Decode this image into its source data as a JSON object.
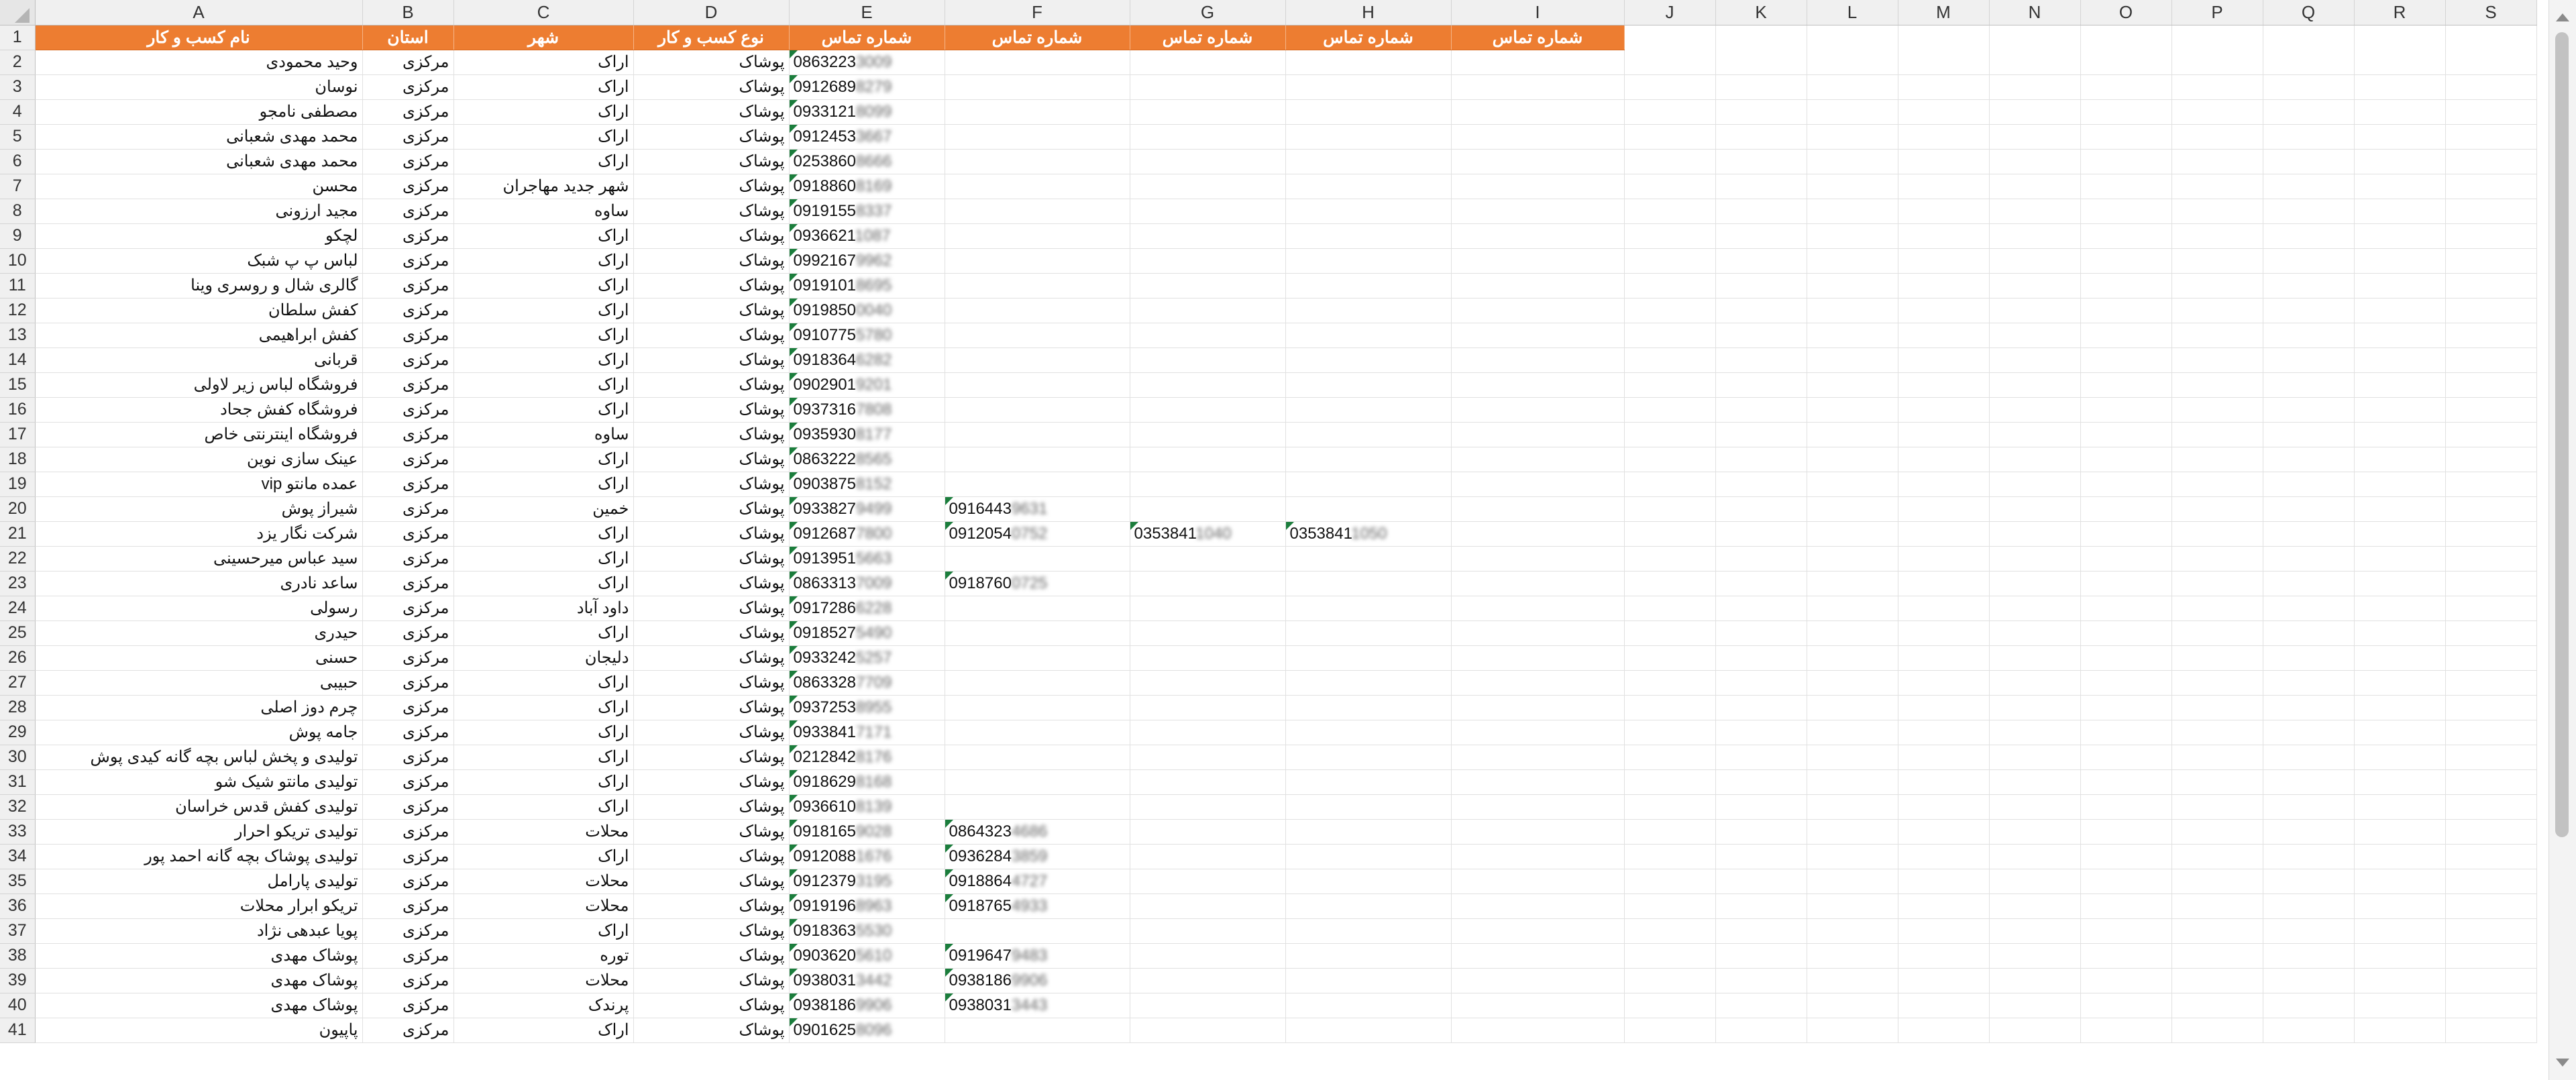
{
  "columns": [
    "A",
    "B",
    "C",
    "D",
    "E",
    "F",
    "G",
    "H",
    "I",
    "J",
    "K",
    "L",
    "M",
    "N",
    "O",
    "P",
    "Q",
    "R",
    "S"
  ],
  "header": {
    "name": "نام کسب و کار",
    "province": "استان",
    "city": "شهر",
    "type": "نوع کسب و کار",
    "p1": "شماره تماس",
    "p2": "شماره تماس",
    "p3": "شماره تماس",
    "p4": "شماره تماس",
    "p5": "شماره تماس"
  },
  "rows": [
    {
      "n": "2",
      "name": "وحید محمودی",
      "province": "مرکزی",
      "city": "اراک",
      "type": "پوشاک",
      "p1": "0863223",
      "p1b": "3009"
    },
    {
      "n": "3",
      "name": "نوسان",
      "province": "مرکزی",
      "city": "اراک",
      "type": "پوشاک",
      "p1": "0912689",
      "p1b": "8279"
    },
    {
      "n": "4",
      "name": "مصطفی نامجو",
      "province": "مرکزی",
      "city": "اراک",
      "type": "پوشاک",
      "p1": "0933121",
      "p1b": "8099"
    },
    {
      "n": "5",
      "name": "محمد مهدی شعبانی",
      "province": "مرکزی",
      "city": "اراک",
      "type": "پوشاک",
      "p1": "0912453",
      "p1b": "3667"
    },
    {
      "n": "6",
      "name": "محمد مهدی شعبانی",
      "province": "مرکزی",
      "city": "اراک",
      "type": "پوشاک",
      "p1": "0253860",
      "p1b": "8666"
    },
    {
      "n": "7",
      "name": "محسن",
      "province": "مرکزی",
      "city": "شهر جدید مهاجران",
      "type": "پوشاک",
      "p1": "0918860",
      "p1b": "8169"
    },
    {
      "n": "8",
      "name": "مجید ارزونی",
      "province": "مرکزی",
      "city": "ساوه",
      "type": "پوشاک",
      "p1": "0919155",
      "p1b": "8337"
    },
    {
      "n": "9",
      "name": "لچکو",
      "province": "مرکزی",
      "city": "اراک",
      "type": "پوشاک",
      "p1": "0936621",
      "p1b": "1087"
    },
    {
      "n": "10",
      "name": "لباس پ پ شبک",
      "province": "مرکزی",
      "city": "اراک",
      "type": "پوشاک",
      "p1": "0992167",
      "p1b": "9962"
    },
    {
      "n": "11",
      "name": "گالری شال و روسری وینا",
      "province": "مرکزی",
      "city": "اراک",
      "type": "پوشاک",
      "p1": "0919101",
      "p1b": "8695"
    },
    {
      "n": "12",
      "name": "کفش سلطان",
      "province": "مرکزی",
      "city": "اراک",
      "type": "پوشاک",
      "p1": "0919850",
      "p1b": "0040"
    },
    {
      "n": "13",
      "name": "کفش ابراهیمی",
      "province": "مرکزی",
      "city": "اراک",
      "type": "پوشاک",
      "p1": "0910775",
      "p1b": "5780"
    },
    {
      "n": "14",
      "name": "قربانی",
      "province": "مرکزی",
      "city": "اراک",
      "type": "پوشاک",
      "p1": "0918364",
      "p1b": "6282"
    },
    {
      "n": "15",
      "name": "فروشگاه لباس زیر لاولی",
      "province": "مرکزی",
      "city": "اراک",
      "type": "پوشاک",
      "p1": "0902901",
      "p1b": "9201"
    },
    {
      "n": "16",
      "name": "فروشگاه کفش جحاد",
      "province": "مرکزی",
      "city": "اراک",
      "type": "پوشاک",
      "p1": "0937316",
      "p1b": "7808"
    },
    {
      "n": "17",
      "name": "فروشگاه اینترنتی خاص",
      "province": "مرکزی",
      "city": "ساوه",
      "type": "پوشاک",
      "p1": "0935930",
      "p1b": "8177"
    },
    {
      "n": "18",
      "name": "عینک سازی نوین",
      "province": "مرکزی",
      "city": "اراک",
      "type": "پوشاک",
      "p1": "0863222",
      "p1b": "8565"
    },
    {
      "n": "19",
      "name": "عمده مانتو vip",
      "province": "مرکزی",
      "city": "اراک",
      "type": "پوشاک",
      "p1": "0903875",
      "p1b": "8152"
    },
    {
      "n": "20",
      "name": "شیراز پوش",
      "province": "مرکزی",
      "city": "خمین",
      "type": "پوشاک",
      "p1": "0933827",
      "p1b": "9499",
      "p2": "0916443",
      "p2b": "9631"
    },
    {
      "n": "21",
      "name": "شرکت نگار یزد",
      "province": "مرکزی",
      "city": "اراک",
      "type": "پوشاک",
      "p1": "0912687",
      "p1b": "7800",
      "p2": "0912054",
      "p2b": "0752",
      "p3": "0353841",
      "p3b": "1040",
      "p4": "0353841",
      "p4b": "1050"
    },
    {
      "n": "22",
      "name": "سید عباس میرحسینی",
      "province": "مرکزی",
      "city": "اراک",
      "type": "پوشاک",
      "p1": "0913951",
      "p1b": "5663"
    },
    {
      "n": "23",
      "name": "ساعد نادری",
      "province": "مرکزی",
      "city": "اراک",
      "type": "پوشاک",
      "p1": "0863313",
      "p1b": "7009",
      "p2": "0918760",
      "p2b": "0725"
    },
    {
      "n": "24",
      "name": "رسولی",
      "province": "مرکزی",
      "city": "داود آباد",
      "type": "پوشاک",
      "p1": "0917286",
      "p1b": "6228"
    },
    {
      "n": "25",
      "name": "حیدری",
      "province": "مرکزی",
      "city": "اراک",
      "type": "پوشاک",
      "p1": "0918527",
      "p1b": "5490"
    },
    {
      "n": "26",
      "name": "حسنی",
      "province": "مرکزی",
      "city": "دلیجان",
      "type": "پوشاک",
      "p1": "0933242",
      "p1b": "5257"
    },
    {
      "n": "27",
      "name": "حبیبی",
      "province": "مرکزی",
      "city": "اراک",
      "type": "پوشاک",
      "p1": "0863328",
      "p1b": "7709"
    },
    {
      "n": "28",
      "name": "چرم دوز اصلی",
      "province": "مرکزی",
      "city": "اراک",
      "type": "پوشاک",
      "p1": "0937253",
      "p1b": "8955"
    },
    {
      "n": "29",
      "name": "جامه پوش",
      "province": "مرکزی",
      "city": "اراک",
      "type": "پوشاک",
      "p1": "0933841",
      "p1b": "7171"
    },
    {
      "n": "30",
      "name": "تولیدی و پخش لباس بچه گانه کیدی پوش",
      "province": "مرکزی",
      "city": "اراک",
      "type": "پوشاک",
      "p1": "0212842",
      "p1b": "8176"
    },
    {
      "n": "31",
      "name": "تولیدی مانتو شیک شو",
      "province": "مرکزی",
      "city": "اراک",
      "type": "پوشاک",
      "p1": "0918629",
      "p1b": "8168"
    },
    {
      "n": "32",
      "name": "تولیدی کفش قدس خراسان",
      "province": "مرکزی",
      "city": "اراک",
      "type": "پوشاک",
      "p1": "0936610",
      "p1b": "8139"
    },
    {
      "n": "33",
      "name": "تولیدی تریکو احرار",
      "province": "مرکزی",
      "city": "محلات",
      "type": "پوشاک",
      "p1": "0918165",
      "p1b": "9028",
      "p2": "0864323",
      "p2b": "4686"
    },
    {
      "n": "34",
      "name": "تولیدی پوشاک بچه گانه  احمد پور",
      "province": "مرکزی",
      "city": "اراک",
      "type": "پوشاک",
      "p1": "0912088",
      "p1b": "1676",
      "p2": "0936284",
      "p2b": "3859"
    },
    {
      "n": "35",
      "name": "تولیدی پارامل",
      "province": "مرکزی",
      "city": "محلات",
      "type": "پوشاک",
      "p1": "0912379",
      "p1b": "3195",
      "p2": "0918864",
      "p2b": "4727"
    },
    {
      "n": "36",
      "name": "تریکو ابرار محلات",
      "province": "مرکزی",
      "city": "محلات",
      "type": "پوشاک",
      "p1": "0919196",
      "p1b": "8963",
      "p2": "0918765",
      "p2b": "4933"
    },
    {
      "n": "37",
      "name": "پویا عبدهی نژاد",
      "province": "مرکزی",
      "city": "اراک",
      "type": "پوشاک",
      "p1": "0918363",
      "p1b": "5530"
    },
    {
      "n": "38",
      "name": "پوشاک مهدی",
      "province": "مرکزی",
      "city": "توره",
      "type": "پوشاک",
      "p1": "0903620",
      "p1b": "5610",
      "p2": "0919647",
      "p2b": "9483"
    },
    {
      "n": "39",
      "name": "پوشاک مهدی",
      "province": "مرکزی",
      "city": "محلات",
      "type": "پوشاک",
      "p1": "0938031",
      "p1b": "3442",
      "p2": "0938186",
      "p2b": "9906"
    },
    {
      "n": "40",
      "name": "پوشاک مهدی",
      "province": "مرکزی",
      "city": "پرندک",
      "type": "پوشاک",
      "p1": "0938186",
      "p1b": "9906",
      "p2": "0938031",
      "p2b": "3443"
    },
    {
      "n": "41",
      "name": "پاپیون",
      "province": "مرکزی",
      "city": "اراک",
      "type": "پوشاک",
      "p1": "0901625",
      "p1b": "8096"
    }
  ]
}
